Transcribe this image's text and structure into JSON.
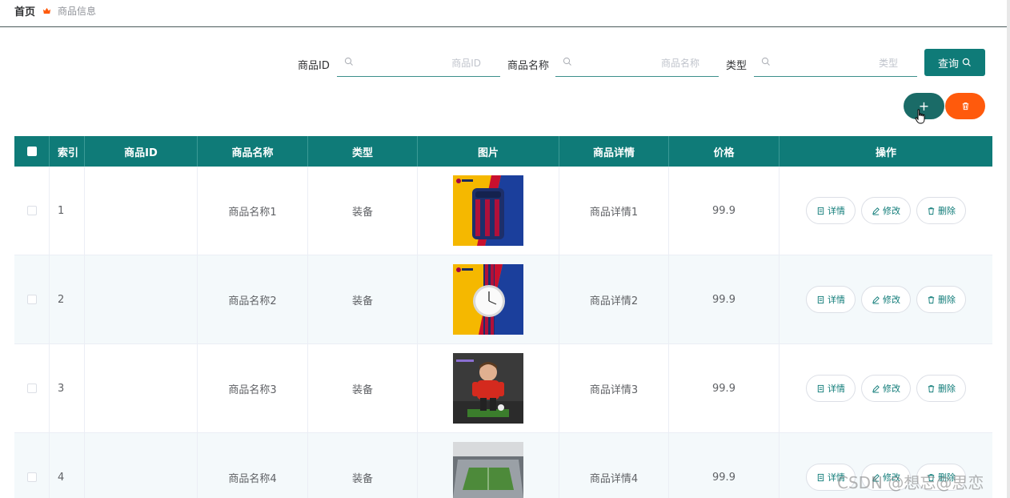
{
  "breadcrumb": {
    "home": "首页",
    "current": "商品信息"
  },
  "search": {
    "fields": [
      {
        "label": "商品ID",
        "placeholder": "商品ID",
        "value": ""
      },
      {
        "label": "商品名称",
        "placeholder": "商品名称",
        "value": ""
      },
      {
        "label": "类型",
        "placeholder": "类型",
        "value": ""
      }
    ],
    "query_label": "查询"
  },
  "actions": {
    "add_symbol": "+",
    "add_icon": "plus-icon",
    "delete_icon": "trash-icon"
  },
  "table": {
    "headers": [
      "索引",
      "商品ID",
      "商品名称",
      "类型",
      "图片",
      "商品详情",
      "价格",
      "操作"
    ],
    "row_buttons": {
      "detail": "详情",
      "edit": "修改",
      "delete": "删除"
    },
    "rows": [
      {
        "index": "1",
        "id": "",
        "name": "商品名称1",
        "type": "装备",
        "image": "barca-backpack",
        "detail": "商品详情1",
        "price": "99.9"
      },
      {
        "index": "2",
        "id": "",
        "name": "商品名称2",
        "type": "装备",
        "image": "barca-watch",
        "detail": "商品详情2",
        "price": "99.9"
      },
      {
        "index": "3",
        "id": "",
        "name": "商品名称3",
        "type": "装备",
        "image": "player-figurine",
        "detail": "商品详情3",
        "price": "99.9"
      },
      {
        "index": "4",
        "id": "",
        "name": "商品名称4",
        "type": "装备",
        "image": "stadium-model",
        "detail": "商品详情4",
        "price": "99.9"
      }
    ]
  },
  "watermark": "CSDN @想忘@思恋",
  "colors": {
    "primary": "#0f7b78",
    "danger": "#ff5a0c",
    "add_button": "#1a6b67",
    "row_alt": "#f4f9fb"
  }
}
